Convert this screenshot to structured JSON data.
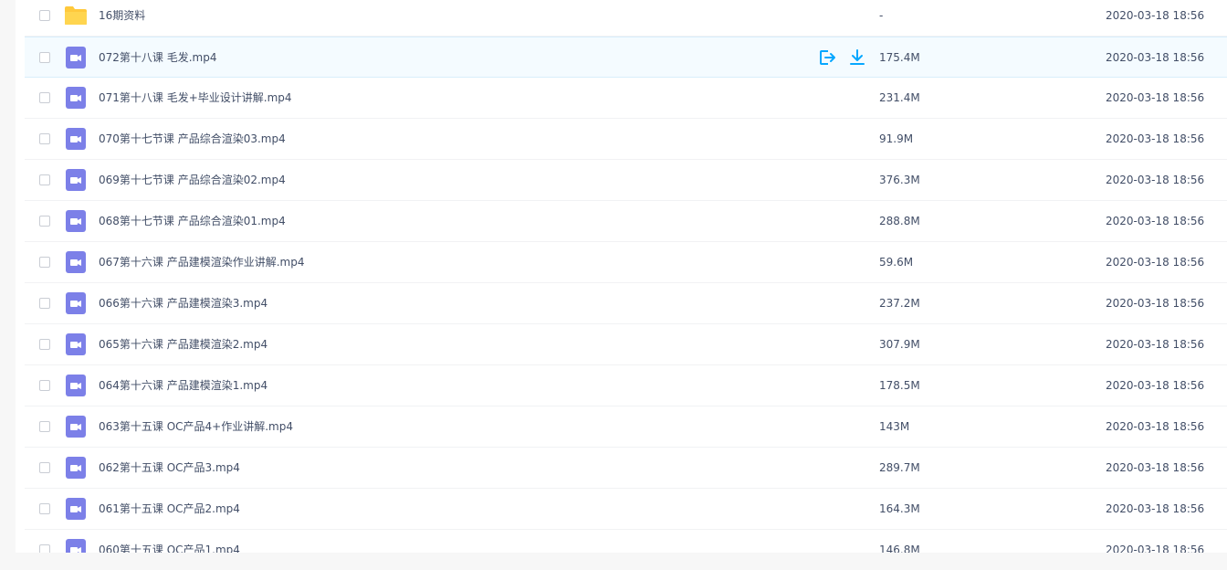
{
  "files": [
    {
      "name": "16期资料",
      "size": "-",
      "date": "2020-03-18 18:56",
      "type": "folder"
    },
    {
      "name": "072第十八课 毛发.mp4",
      "size": "175.4M",
      "date": "2020-03-18 18:56",
      "type": "video"
    },
    {
      "name": "071第十八课 毛发+毕业设计讲解.mp4",
      "size": "231.4M",
      "date": "2020-03-18 18:56",
      "type": "video"
    },
    {
      "name": "070第十七节课 产品综合渲染03.mp4",
      "size": "91.9M",
      "date": "2020-03-18 18:56",
      "type": "video"
    },
    {
      "name": "069第十七节课 产品综合渲染02.mp4",
      "size": "376.3M",
      "date": "2020-03-18 18:56",
      "type": "video"
    },
    {
      "name": "068第十七节课 产品综合渲染01.mp4",
      "size": "288.8M",
      "date": "2020-03-18 18:56",
      "type": "video"
    },
    {
      "name": "067第十六课 产品建模渲染作业讲解.mp4",
      "size": "59.6M",
      "date": "2020-03-18 18:56",
      "type": "video"
    },
    {
      "name": "066第十六课 产品建模渲染3.mp4",
      "size": "237.2M",
      "date": "2020-03-18 18:56",
      "type": "video"
    },
    {
      "name": "065第十六课 产品建模渲染2.mp4",
      "size": "307.9M",
      "date": "2020-03-18 18:56",
      "type": "video"
    },
    {
      "name": "064第十六课 产品建模渲染1.mp4",
      "size": "178.5M",
      "date": "2020-03-18 18:56",
      "type": "video"
    },
    {
      "name": "063第十五课 OC产品4+作业讲解.mp4",
      "size": "143M",
      "date": "2020-03-18 18:56",
      "type": "video"
    },
    {
      "name": "062第十五课 OC产品3.mp4",
      "size": "289.7M",
      "date": "2020-03-18 18:56",
      "type": "video"
    },
    {
      "name": "061第十五课 OC产品2.mp4",
      "size": "164.3M",
      "date": "2020-03-18 18:56",
      "type": "video"
    },
    {
      "name": "060第十五课 OC产品1.mp4",
      "size": "146.8M",
      "date": "2020-03-18 18:56",
      "type": "video"
    }
  ],
  "hover_row": 1,
  "icons": {
    "folder": "folder-icon",
    "video": "video-file-icon",
    "share": "share-icon",
    "download": "download-icon"
  },
  "colors": {
    "folder": "#ffd54f",
    "video": "#7c80e8",
    "action": "#06a7ff",
    "hover_bg": "#f4fbff"
  }
}
